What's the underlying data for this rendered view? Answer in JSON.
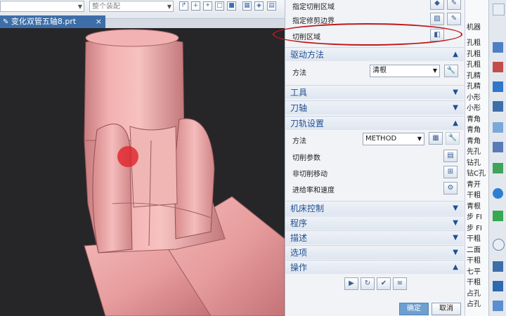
{
  "toolbar": {
    "filter_combo_1": "",
    "filter_combo_2": "整个装配"
  },
  "file_tab": {
    "filename": "变化双管五轴8.prt",
    "modified_mark": "✎",
    "close_glyph": "×"
  },
  "dialog": {
    "geometry_rows": [
      {
        "label": "指定切削区域"
      },
      {
        "label": "指定修剪边界"
      },
      {
        "label": "切削区域"
      }
    ],
    "drive_method": {
      "title": "驱动方法",
      "method_label": "方法",
      "method_value": "清根"
    },
    "collapsed_sections_1": [
      {
        "title": "工具"
      },
      {
        "title": "刀轴"
      }
    ],
    "toolpath_settings": {
      "title": "刀轨设置",
      "method_label": "方法",
      "method_value": "METHOD",
      "cut_params": "切削参数",
      "non_cut_moves": "非切削移动",
      "feeds_speeds": "进给率和速度"
    },
    "collapsed_sections_2": [
      {
        "title": "机床控制"
      },
      {
        "title": "程序"
      },
      {
        "title": "描述"
      },
      {
        "title": "选项"
      }
    ],
    "actions": {
      "title": "操作"
    },
    "ok_label": "确定",
    "cancel_label": "取消"
  },
  "navigator": {
    "header": "机器",
    "items": [
      "孔粗",
      "孔粗",
      "孔粗",
      "孔精",
      "孔精",
      "小形",
      "小形",
      "青角",
      "青角",
      "青角",
      "先孔",
      "钻孔",
      "钻C孔",
      "青开",
      "干粗",
      "青根",
      "步 FI",
      "步 FI",
      "干粗",
      "二面",
      "干粗",
      "七平",
      "干粗",
      "占孔",
      "占孔"
    ]
  },
  "colors": {
    "accent": "#3d6ea9",
    "section_text": "#1f4f91",
    "highlight_ellipse": "#c01818",
    "ok_button": "#6d9fd0"
  }
}
